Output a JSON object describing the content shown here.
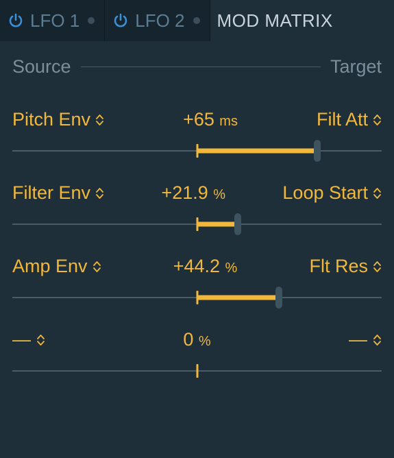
{
  "tabs": {
    "lfo1": "LFO 1",
    "lfo2": "LFO 2",
    "modmatrix": "MOD MATRIX"
  },
  "header": {
    "source": "Source",
    "target": "Target"
  },
  "rows": [
    {
      "source": "Pitch Env",
      "target": "Filt Att",
      "value_num": "+65",
      "value_unit": "ms",
      "pct": 65,
      "empty": false
    },
    {
      "source": "Filter Env",
      "target": "Loop Start",
      "value_num": "+21.9",
      "value_unit": "%",
      "pct": 21.9,
      "empty": false
    },
    {
      "source": "Amp Env",
      "target": "Flt Res",
      "value_num": "+44.2",
      "value_unit": "%",
      "pct": 44.2,
      "empty": false
    },
    {
      "source": "—",
      "target": "—",
      "value_num": "0",
      "value_unit": "%",
      "pct": 0,
      "empty": true
    }
  ],
  "colors": {
    "accent": "#f2b83b",
    "power": "#3a8fd6"
  }
}
